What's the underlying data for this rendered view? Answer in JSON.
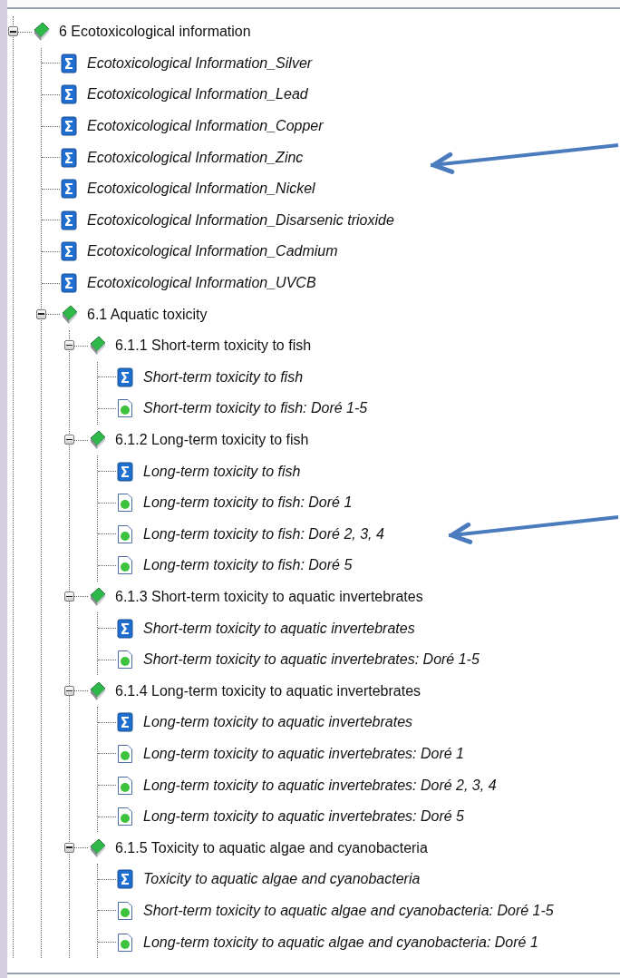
{
  "tree": [
    {
      "kind": "folder",
      "label": "6 Ecotoxicological information",
      "expanded": true,
      "children": [
        {
          "kind": "summary",
          "label": "Ecotoxicological Information_Silver"
        },
        {
          "kind": "summary",
          "label": "Ecotoxicological Information_Lead"
        },
        {
          "kind": "summary",
          "label": "Ecotoxicological Information_Copper"
        },
        {
          "kind": "summary",
          "label": "Ecotoxicological Information_Zinc"
        },
        {
          "kind": "summary",
          "label": "Ecotoxicological Information_Nickel"
        },
        {
          "kind": "summary",
          "label": "Ecotoxicological Information_Disarsenic trioxide"
        },
        {
          "kind": "summary",
          "label": "Ecotoxicological Information_Cadmium"
        },
        {
          "kind": "summary",
          "label": "Ecotoxicological Information_UVCB"
        },
        {
          "kind": "folder",
          "label": "6.1 Aquatic toxicity",
          "expanded": true,
          "children": [
            {
              "kind": "folder",
              "label": "6.1.1 Short-term toxicity to fish",
              "expanded": true,
              "children": [
                {
                  "kind": "summary",
                  "label": "Short-term toxicity to fish"
                },
                {
                  "kind": "record",
                  "label": "Short-term toxicity to fish: Doré 1-5"
                }
              ]
            },
            {
              "kind": "folder",
              "label": "6.1.2 Long-term toxicity to fish",
              "expanded": true,
              "children": [
                {
                  "kind": "summary",
                  "label": "Long-term toxicity to fish"
                },
                {
                  "kind": "record",
                  "label": "Long-term toxicity to fish: Doré 1"
                },
                {
                  "kind": "record",
                  "label": "Long-term toxicity to fish: Doré 2, 3, 4"
                },
                {
                  "kind": "record",
                  "label": "Long-term toxicity to fish: Doré 5"
                }
              ]
            },
            {
              "kind": "folder",
              "label": "6.1.3 Short-term toxicity to aquatic invertebrates",
              "expanded": true,
              "children": [
                {
                  "kind": "summary",
                  "label": "Short-term toxicity to aquatic invertebrates"
                },
                {
                  "kind": "record",
                  "label": "Short-term toxicity to aquatic invertebrates: Doré 1-5"
                }
              ]
            },
            {
              "kind": "folder",
              "label": "6.1.4 Long-term toxicity to aquatic invertebrates",
              "expanded": true,
              "children": [
                {
                  "kind": "summary",
                  "label": "Long-term toxicity to aquatic invertebrates"
                },
                {
                  "kind": "record",
                  "label": "Long-term toxicity to aquatic invertebrates: Doré 1"
                },
                {
                  "kind": "record",
                  "label": "Long-term toxicity to aquatic invertebrates: Doré 2, 3, 4"
                },
                {
                  "kind": "record",
                  "label": "Long-term toxicity to aquatic invertebrates: Doré 5"
                }
              ]
            },
            {
              "kind": "folder",
              "label": "6.1.5 Toxicity to aquatic algae and cyanobacteria",
              "expanded": true,
              "children": [
                {
                  "kind": "summary",
                  "label": "Toxicity to aquatic algae and cyanobacteria"
                },
                {
                  "kind": "record",
                  "label": "Short-term toxicity to aquatic algae and cyanobacteria: Doré 1-5"
                },
                {
                  "kind": "record",
                  "label": "Long-term toxicity to aquatic algae and cyanobacteria: Doré 1"
                }
              ]
            }
          ]
        }
      ]
    }
  ]
}
